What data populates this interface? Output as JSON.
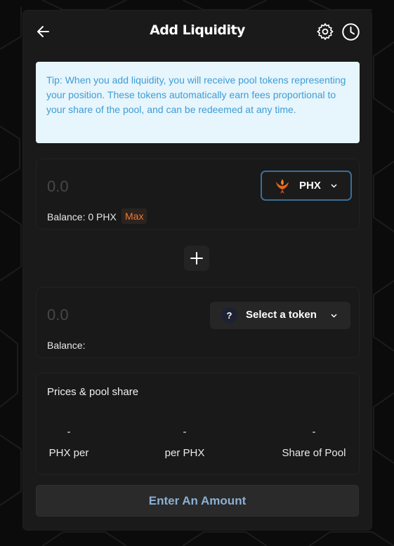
{
  "header": {
    "title": "Add Liquidity",
    "back_icon": "arrow-left-icon",
    "settings_icon": "gear-icon",
    "history_icon": "clock-icon"
  },
  "tip": {
    "text": "Tip: When you add liquidity, you will receive pool tokens representing your position. These tokens automatically earn fees proportional to your share of the pool, and can be redeemed at any time."
  },
  "input_a": {
    "placeholder": "0.0",
    "token_symbol": "PHX",
    "token_icon": "phoenix-logo-icon",
    "balance_label": "Balance: 0 PHX",
    "max_label": "Max"
  },
  "plus_icon": "plus-icon",
  "input_b": {
    "placeholder": "0.0",
    "token_icon_text": "?",
    "select_label": "Select a token",
    "balance_label": "Balance:"
  },
  "prices": {
    "title": "Prices & pool share",
    "columns": [
      {
        "value": "-",
        "label": "PHX per"
      },
      {
        "value": "-",
        "label": "per PHX"
      },
      {
        "value": "-",
        "label": "Share of Pool"
      }
    ]
  },
  "submit": {
    "label": "Enter An Amount"
  },
  "colors": {
    "accent_blue": "#3a6e9a",
    "tip_bg": "#e7f5fd",
    "tip_text": "#3d9dd6",
    "max_text": "#f07a2e",
    "phoenix_orange": "#e8661c"
  }
}
